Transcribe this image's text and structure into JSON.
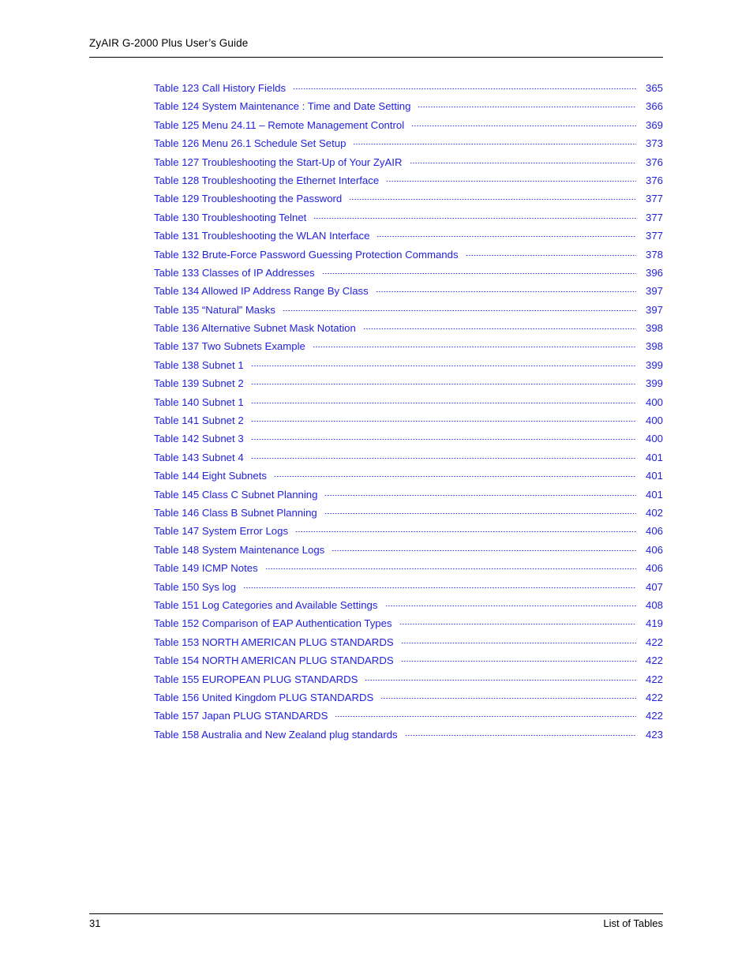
{
  "header": {
    "title": "ZyAIR G-2000 Plus User’s Guide"
  },
  "footer": {
    "page_number": "31",
    "section_label": "List of Tables"
  },
  "toc": {
    "entries": [
      {
        "label": "Table 123 Call History Fields",
        "page": "365"
      },
      {
        "label": "Table 124 System Maintenance : Time and Date Setting",
        "page": "366"
      },
      {
        "label": "Table 125 Menu 24.11 – Remote Management Control",
        "page": "369"
      },
      {
        "label": "Table 126 Menu 26.1 Schedule Set Setup",
        "page": "373"
      },
      {
        "label": "Table 127 Troubleshooting the Start-Up of Your ZyAIR",
        "page": "376"
      },
      {
        "label": "Table 128 Troubleshooting the Ethernet Interface",
        "page": "376"
      },
      {
        "label": "Table 129 Troubleshooting the Password",
        "page": "377"
      },
      {
        "label": "Table 130 Troubleshooting Telnet",
        "page": "377"
      },
      {
        "label": "Table 131 Troubleshooting the WLAN Interface",
        "page": "377"
      },
      {
        "label": "Table 132 Brute-Force Password Guessing Protection Commands",
        "page": "378"
      },
      {
        "label": "Table 133 Classes of IP Addresses",
        "page": "396"
      },
      {
        "label": "Table 134 Allowed IP Address Range By Class",
        "page": "397"
      },
      {
        "label": "Table 135  “Natural” Masks",
        "page": "397"
      },
      {
        "label": "Table 136 Alternative Subnet Mask Notation",
        "page": "398"
      },
      {
        "label": "Table 137 Two Subnets Example",
        "page": "398"
      },
      {
        "label": "Table 138 Subnet 1",
        "page": "399"
      },
      {
        "label": "Table 139 Subnet 2",
        "page": "399"
      },
      {
        "label": "Table 140 Subnet 1",
        "page": "400"
      },
      {
        "label": "Table 141 Subnet 2",
        "page": "400"
      },
      {
        "label": "Table 142 Subnet 3",
        "page": "400"
      },
      {
        "label": "Table 143 Subnet 4",
        "page": "401"
      },
      {
        "label": "Table 144 Eight Subnets",
        "page": "401"
      },
      {
        "label": "Table 145 Class C Subnet Planning",
        "page": "401"
      },
      {
        "label": "Table 146 Class B Subnet Planning",
        "page": "402"
      },
      {
        "label": "Table 147 System Error Logs",
        "page": "406"
      },
      {
        "label": "Table 148 System Maintenance Logs",
        "page": "406"
      },
      {
        "label": "Table 149 ICMP Notes",
        "page": "406"
      },
      {
        "label": "Table 150 Sys log",
        "page": "407"
      },
      {
        "label": "Table 151 Log Categories and Available Settings",
        "page": "408"
      },
      {
        "label": "Table 152 Comparison of EAP Authentication Types",
        "page": "419"
      },
      {
        "label": "Table 153 NORTH AMERICAN PLUG STANDARDS",
        "page": "422"
      },
      {
        "label": "Table 154 NORTH AMERICAN PLUG STANDARDS",
        "page": "422"
      },
      {
        "label": "Table 155 EUROPEAN PLUG STANDARDS",
        "page": "422"
      },
      {
        "label": "Table 156 United Kingdom PLUG STANDARDS",
        "page": "422"
      },
      {
        "label": "Table 157 Japan PLUG STANDARDS",
        "page": "422"
      },
      {
        "label": "Table 158 Australia and New Zealand plug standards",
        "page": "423"
      }
    ]
  },
  "colors": {
    "toc_link": "#2222dd",
    "body_text": "#000000",
    "page_background": "#ffffff"
  }
}
